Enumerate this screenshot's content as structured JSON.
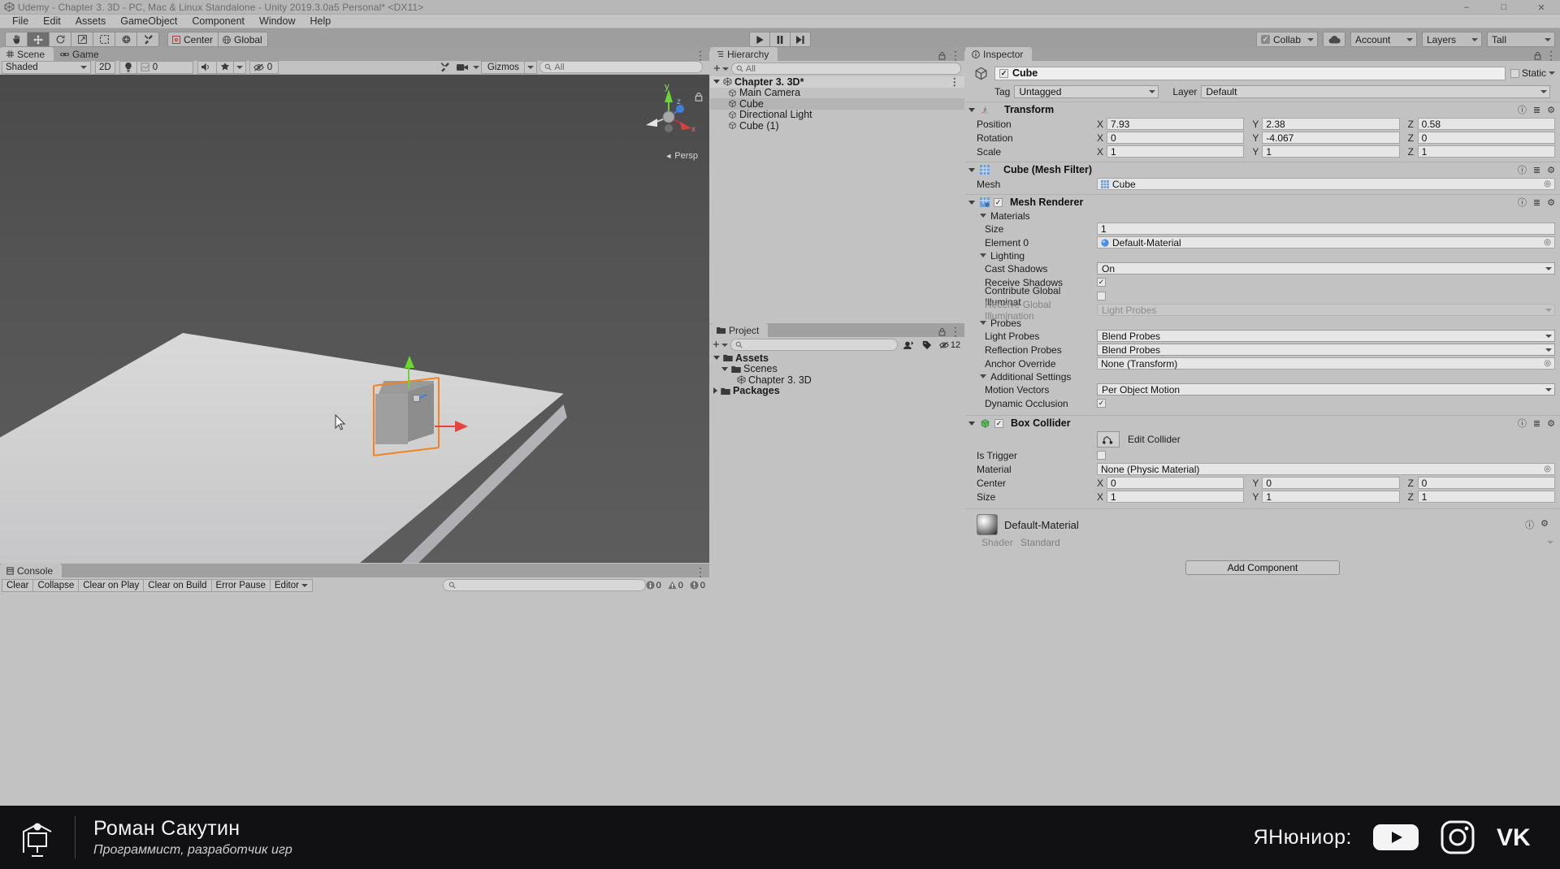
{
  "window": {
    "title": "Udemy - Chapter 3. 3D - PC, Mac & Linux Standalone - Unity 2019.3.0a5 Personal* <DX11>",
    "minimize": "–",
    "maximize": "□",
    "close": "✕"
  },
  "menu": [
    "File",
    "Edit",
    "Assets",
    "GameObject",
    "Component",
    "Window",
    "Help"
  ],
  "toolbar": {
    "tools": [
      {
        "name": "hand-tool",
        "glyph": "✋"
      },
      {
        "name": "move-tool",
        "glyph": "✥"
      },
      {
        "name": "rotate-tool",
        "glyph": "↻"
      },
      {
        "name": "scale-tool",
        "glyph": "↗"
      },
      {
        "name": "rect-tool",
        "glyph": "⬚"
      },
      {
        "name": "transform-tool",
        "glyph": "⬡"
      },
      {
        "name": "custom-tool",
        "glyph": "⚒"
      }
    ],
    "pivot_label": "Center",
    "space_label": "Global",
    "play": "▶",
    "pause": "‖",
    "step": "▶|",
    "collab_label": "Collab",
    "cloud_icon": "cloud-icon",
    "account_label": "Account",
    "layers_label": "Layers",
    "layout_label": "Tall"
  },
  "scene": {
    "tabs": [
      {
        "label": "Scene",
        "icon": "grid-icon",
        "active": true
      },
      {
        "label": "Game",
        "icon": "gamepad-icon",
        "active": false
      }
    ],
    "draw_mode": "Shaded",
    "mode_2d": "2D",
    "lighting_icon": "lightbulb-icon",
    "fx_value": "0",
    "audio_icon": "audio-icon",
    "effects_icon": "effects-icon",
    "hidden_count": "0",
    "tools_icon": "tools-icon",
    "camera_icon": "camera-icon",
    "gizmos_label": "Gizmos",
    "search_placeholder": "All",
    "axis_labels": {
      "y": "y",
      "z": "z",
      "x": "x"
    },
    "persp_label": "Persp"
  },
  "hierarchy": {
    "tab_label": "Hierarchy",
    "search_placeholder": "All",
    "add_label": "+",
    "items": [
      {
        "label": "Chapter 3. 3D*",
        "depth": 0,
        "icon": "unity-scene-icon",
        "selected": false,
        "root": true
      },
      {
        "label": "Main Camera",
        "depth": 1,
        "icon": "gameobject-icon",
        "selected": false
      },
      {
        "label": "Cube",
        "depth": 1,
        "icon": "gameobject-icon",
        "selected": true
      },
      {
        "label": "Directional Light",
        "depth": 1,
        "icon": "gameobject-icon",
        "selected": false
      },
      {
        "label": "Cube (1)",
        "depth": 1,
        "icon": "gameobject-icon",
        "selected": false
      }
    ]
  },
  "project": {
    "tab_label": "Project",
    "search_placeholder": "",
    "badge_count": "12",
    "items": [
      {
        "label": "Assets",
        "depth": 0,
        "icon": "folder-icon",
        "expanded": true,
        "bold": true
      },
      {
        "label": "Scenes",
        "depth": 1,
        "icon": "folder-icon",
        "expanded": true,
        "bold": false
      },
      {
        "label": "Chapter 3. 3D",
        "depth": 2,
        "icon": "unity-scene-icon",
        "expanded": null,
        "bold": false
      },
      {
        "label": "Packages",
        "depth": 0,
        "icon": "folder-icon",
        "expanded": false,
        "bold": true
      }
    ]
  },
  "console": {
    "tab_label": "Console",
    "buttons": [
      "Clear",
      "Collapse",
      "Clear on Play",
      "Clear on Build",
      "Error Pause"
    ],
    "editor_label": "Editor",
    "search_placeholder": "",
    "counts": {
      "log": "0",
      "warning": "0",
      "error": "0"
    }
  },
  "inspector": {
    "tab_label": "Inspector",
    "object_name": "Cube",
    "enabled": true,
    "static_label": "Static",
    "tag_label": "Tag",
    "tag_value": "Untagged",
    "layer_label": "Layer",
    "layer_value": "Default",
    "components": [
      {
        "name": "Transform",
        "icon": "transform-icon",
        "rows": [
          {
            "label": "Position",
            "type": "vec3",
            "x": "7.93",
            "y": "2.38",
            "z": "0.58"
          },
          {
            "label": "Rotation",
            "type": "vec3",
            "x": "0",
            "y": "-4.067",
            "z": "0"
          },
          {
            "label": "Scale",
            "type": "vec3",
            "x": "1",
            "y": "1",
            "z": "1"
          }
        ]
      },
      {
        "name": "Cube (Mesh Filter)",
        "icon": "meshfilter-icon",
        "rows": [
          {
            "label": "Mesh",
            "type": "object",
            "value": "Cube",
            "icon": "mesh-icon"
          }
        ]
      },
      {
        "name": "Mesh Renderer",
        "icon": "meshrenderer-icon",
        "checkbox": true,
        "rows": [
          {
            "label": "Materials",
            "type": "foldout"
          },
          {
            "label": "Size",
            "type": "text",
            "value": "1",
            "indent": true
          },
          {
            "label": "Element 0",
            "type": "object",
            "value": "Default-Material",
            "icon": "material-icon",
            "indent": true
          },
          {
            "label": "Lighting",
            "type": "foldout"
          },
          {
            "label": "Cast Shadows",
            "type": "dropdown",
            "value": "On",
            "indent": true
          },
          {
            "label": "Receive Shadows",
            "type": "checkbox",
            "value": true,
            "indent": true
          },
          {
            "label": "Contribute Global Illuminat",
            "type": "checkbox",
            "value": false,
            "indent": true
          },
          {
            "label": "Receive Global Illumination",
            "type": "dropdown",
            "value": "Light Probes",
            "indent": true,
            "disabled": true
          },
          {
            "label": "Probes",
            "type": "foldout"
          },
          {
            "label": "Light Probes",
            "type": "dropdown",
            "value": "Blend Probes",
            "indent": true
          },
          {
            "label": "Reflection Probes",
            "type": "dropdown",
            "value": "Blend Probes",
            "indent": true
          },
          {
            "label": "Anchor Override",
            "type": "object",
            "value": "None (Transform)",
            "indent": true
          },
          {
            "label": "Additional Settings",
            "type": "foldout"
          },
          {
            "label": "Motion Vectors",
            "type": "dropdown",
            "value": "Per Object Motion",
            "indent": true
          },
          {
            "label": "Dynamic Occlusion",
            "type": "checkbox",
            "value": true,
            "indent": true
          }
        ]
      },
      {
        "name": "Box Collider",
        "icon": "boxcollider-icon",
        "checkbox": true,
        "edit_collider_label": "Edit Collider",
        "rows": [
          {
            "label": "Is Trigger",
            "type": "checkbox",
            "value": false
          },
          {
            "label": "Material",
            "type": "object",
            "value": "None (Physic Material)"
          },
          {
            "label": "Center",
            "type": "vec3",
            "x": "0",
            "y": "0",
            "z": "0"
          },
          {
            "label": "Size",
            "type": "vec3",
            "x": "1",
            "y": "1",
            "z": "1"
          }
        ]
      }
    ],
    "material_preview": {
      "name": "Default-Material",
      "shader_label": "Shader",
      "shader_value": "Standard"
    },
    "add_component_label": "Add Component"
  },
  "banner": {
    "name": "Роман Сакутин",
    "subtitle": "Программист, разработчик игр",
    "brand": "ЯНюниор:",
    "socials": [
      "youtube-icon",
      "instagram-icon",
      "vk-icon"
    ]
  },
  "colors": {
    "accent_orange": "#f3821f",
    "axis_x": "#e8433a",
    "axis_y": "#6fd62f",
    "axis_z": "#3d7fe0",
    "panel_bg": "#c2c2c2",
    "toolbar_bg": "#9e9e9e"
  }
}
